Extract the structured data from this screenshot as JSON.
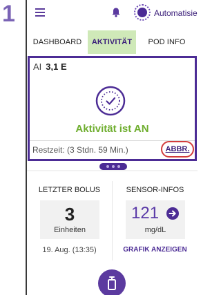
{
  "step": "1",
  "header": {
    "mode_label": "Automatisiert"
  },
  "tabs": [
    {
      "label": "DASHBOARD"
    },
    {
      "label": "AKTIVITÄT"
    },
    {
      "label": "POD INFO"
    }
  ],
  "activity": {
    "ai_label": "AI",
    "ai_value": "3,1 E",
    "status_text": "Aktivität ist AN",
    "remaining": "Restzeit: (3 Stdn. 59 Min.)",
    "cancel_label": "ABBR."
  },
  "bolus": {
    "title": "LETZTER BOLUS",
    "value": "3",
    "unit": "Einheiten",
    "time": "19. Aug. (13:35)"
  },
  "sensor": {
    "title": "SENSOR-INFOS",
    "value": "121",
    "unit": "mg/dL",
    "link": "GRAFIK ANZEIGEN"
  },
  "icons": {
    "menu": "menu-icon",
    "bell": "bell-icon",
    "mode": "mode-status-icon",
    "activity": "activity-check-icon",
    "trend": "arrow-right-icon",
    "bolus": "bolus-icon"
  },
  "colors": {
    "brand": "#4c2c95",
    "active_tab": "#cfe9b8",
    "status_green": "#6fae2f",
    "highlight_red": "#d23c3c"
  }
}
